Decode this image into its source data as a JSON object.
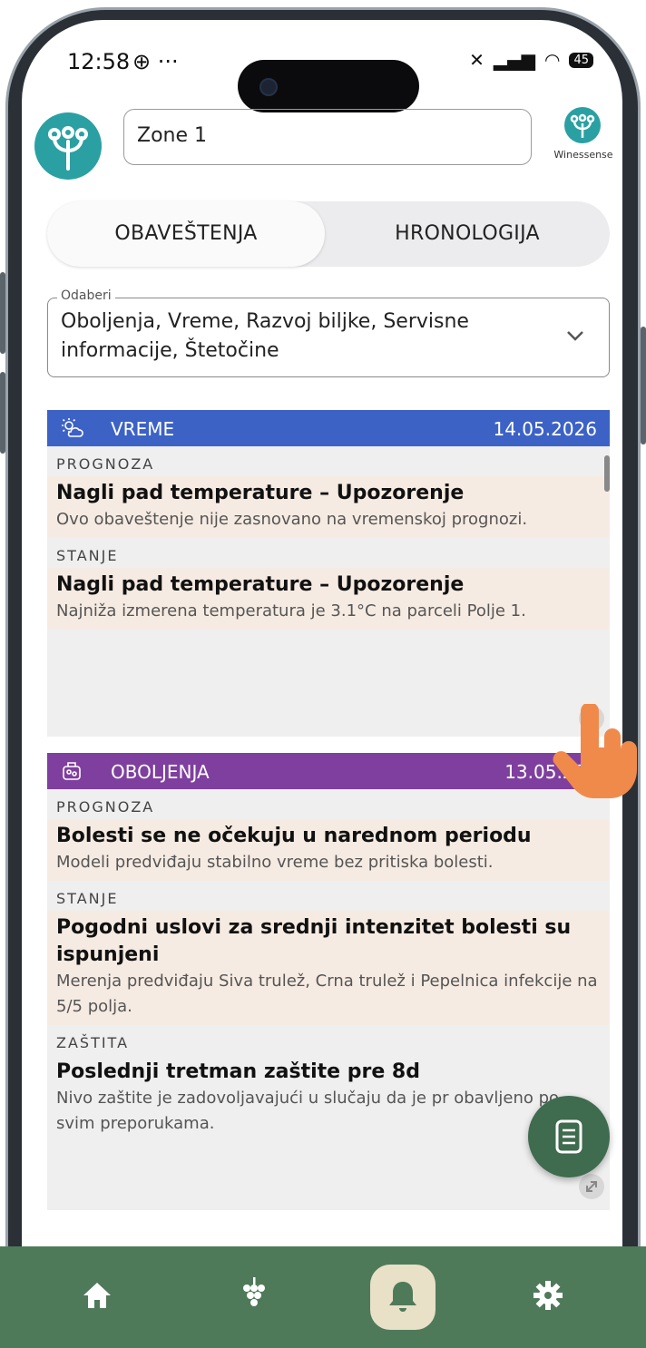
{
  "status": {
    "time": "12:58",
    "battery": "45"
  },
  "header": {
    "zone_value": "Zone 1",
    "brand": "Winessense"
  },
  "tabs": [
    {
      "label": "OBAVEŠTENJA"
    },
    {
      "label": "HRONOLOGIJA"
    }
  ],
  "filter": {
    "label": "Odaberi",
    "value": "Oboljenja, Vreme, Razvoj biljke, Servisne informacije, Štetočine"
  },
  "cards": [
    {
      "type": "VREME",
      "date": "14.05.2026",
      "color": "#3c62c6",
      "sections": [
        {
          "label": "PROGNOZA",
          "title": "Nagli pad temperature – Upozorenje",
          "desc": "Ovo obaveštenje nije zasnovano na vremenskoj prognozi."
        },
        {
          "label": "STANJE",
          "title": "Nagli pad temperature – Upozorenje",
          "desc": "Najniža izmerena temperatura je 3.1°C na parceli Polje 1."
        }
      ]
    },
    {
      "type": "OBOLJENJA",
      "date": "13.05.202",
      "color": "#7f3f9f",
      "sections": [
        {
          "label": "PROGNOZA",
          "title": "Bolesti se ne očekuju u narednom periodu",
          "desc": "Modeli predviđaju stabilno vreme bez pritiska bolesti."
        },
        {
          "label": "STANJE",
          "title": "Pogodni uslovi za srednji intenzitet bolesti su ispunjeni",
          "desc": "Merenja predviđaju Siva trulež, Crna trulež i Pepelnica infekcije na 5/5 polja."
        },
        {
          "label": "ZAŠTITA",
          "title": "Poslednji tretman zaštite pre 8d",
          "desc": "Nivo zaštite je zadovoljavajući u slučaju da je pr obavljeno po svim preporukama."
        }
      ]
    }
  ],
  "colors": {
    "nav": "#4f7a5a",
    "fab": "#3f6b4f",
    "accent": "#2aa0a3",
    "item_bg": "#f6ebe2"
  },
  "nav": {
    "items": [
      "home-icon",
      "grapes-icon",
      "bell-icon",
      "gear-icon"
    ],
    "active": "bell-icon"
  }
}
